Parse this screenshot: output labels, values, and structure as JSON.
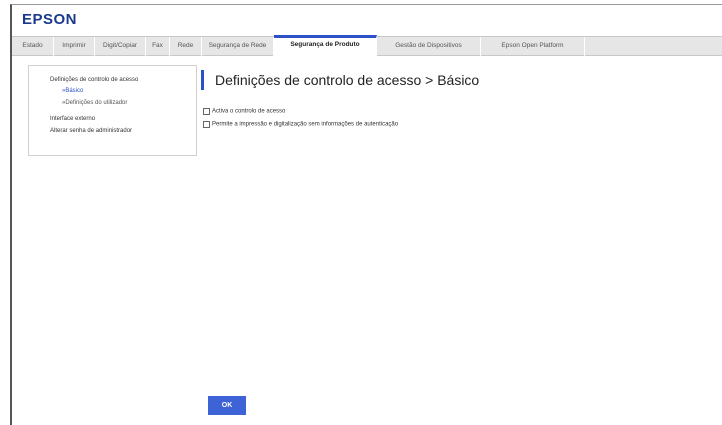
{
  "app": {
    "brand": "EPSON",
    "brand_color": "#1a3a8c",
    "accent_color": "#2b50c8"
  },
  "tabs": [
    {
      "label": "Estado"
    },
    {
      "label": "Imprimir"
    },
    {
      "label": "Digit/Copiar"
    },
    {
      "label": "Fax"
    },
    {
      "label": "Rede"
    },
    {
      "label": "Segurança de Rede"
    },
    {
      "label": "Segurança de Produto",
      "active": true
    },
    {
      "label": "Gestão de Dispositivos"
    },
    {
      "label": "Epson Open Platform"
    }
  ],
  "sidebar": {
    "items": [
      {
        "label": "Definições de controlo de acesso"
      },
      {
        "label": "»Básico"
      },
      {
        "label": "»Definições do utilizador"
      },
      {
        "label": "Interface externo"
      },
      {
        "label": "Alterar senha de administrador"
      }
    ]
  },
  "main": {
    "title": "Definições de controlo de acesso > Básico",
    "options": [
      {
        "label": "Activa o controlo de acesso",
        "checked": false
      },
      {
        "label": "Permite a impressão e digitalização sem informações de autenticação",
        "checked": false
      }
    ]
  },
  "actions": {
    "ok_label": "OK"
  }
}
